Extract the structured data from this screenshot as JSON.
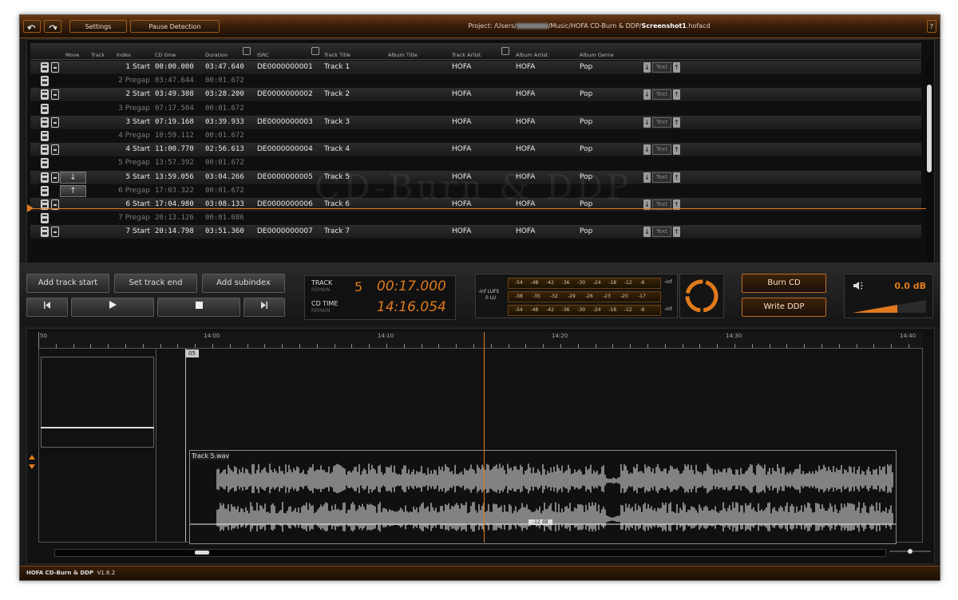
{
  "toolbar": {
    "undo_icon": "undo-icon",
    "redo_icon": "redo-icon",
    "settings_label": "Settings",
    "pause_label": "Pause Detection",
    "project_prefix": "Project: /Users/",
    "project_middle": "/Music/HOFA CD-Burn & DDP/",
    "project_file": "Screenshot1",
    "project_ext": ".hofacd",
    "help_label": "?"
  },
  "columns": {
    "move": "Move",
    "track": "Track",
    "index": "Index",
    "cd_time": "CD time",
    "duration": "Duration",
    "isrc": "ISRC",
    "title": "Track Title",
    "album_title": "Album Title",
    "track_artist": "Track Artist",
    "album_artist": "Album Artist",
    "album_genre": "Album Genre"
  },
  "rows": [
    {
      "type": "start",
      "index": "1 Start",
      "cd_time": "00:00.000",
      "duration": "03:47.640",
      "isrc": "DE0000000001",
      "title": "Track 1",
      "artist": "HOFA",
      "album_artist": "HOFA",
      "genre": "Pop",
      "text": "Text"
    },
    {
      "type": "pregap",
      "index": "2 Pregap",
      "cd_time": "03:47.644",
      "duration": "00:01.672"
    },
    {
      "type": "start",
      "index": "2 Start",
      "cd_time": "03:49.308",
      "duration": "03:28.200",
      "isrc": "DE0000000002",
      "title": "Track 2",
      "artist": "HOFA",
      "album_artist": "HOFA",
      "genre": "Pop",
      "text": "Text"
    },
    {
      "type": "pregap",
      "index": "3 Pregap",
      "cd_time": "07:17.504",
      "duration": "00:01.672"
    },
    {
      "type": "start",
      "index": "3 Start",
      "cd_time": "07:19.168",
      "duration": "03:39.933",
      "isrc": "DE0000000003",
      "title": "Track 3",
      "artist": "HOFA",
      "album_artist": "HOFA",
      "genre": "Pop",
      "text": "Text"
    },
    {
      "type": "pregap",
      "index": "4 Pregap",
      "cd_time": "10:59.112",
      "duration": "00:01.672"
    },
    {
      "type": "start",
      "index": "4 Start",
      "cd_time": "11:00.770",
      "duration": "02:56.613",
      "isrc": "DE0000000004",
      "title": "Track 4",
      "artist": "HOFA",
      "album_artist": "HOFA",
      "genre": "Pop",
      "text": "Text"
    },
    {
      "type": "pregap",
      "index": "5 Pregap",
      "cd_time": "13:57.392",
      "duration": "00:01.672"
    },
    {
      "type": "start",
      "index": "5 Start",
      "cd_time": "13:59.056",
      "duration": "03:04.266",
      "isrc": "DE0000000005",
      "title": "Track 5",
      "artist": "HOFA",
      "album_artist": "HOFA",
      "genre": "Pop",
      "text": "Text",
      "move": "↓"
    },
    {
      "type": "pregap",
      "index": "6 Pregap",
      "cd_time": "17:03.322",
      "duration": "00:01.672",
      "move": "↑"
    },
    {
      "type": "start",
      "index": "6 Start",
      "cd_time": "17:04.980",
      "duration": "03:08.133",
      "isrc": "DE0000000006",
      "title": "Track 6",
      "artist": "HOFA",
      "album_artist": "HOFA",
      "genre": "Pop",
      "text": "Text"
    },
    {
      "type": "pregap",
      "index": "7 Pregap",
      "cd_time": "20:13.126",
      "duration": "00:01.686"
    },
    {
      "type": "start",
      "index": "7 Start",
      "cd_time": "20:14.798",
      "duration": "03:51.360",
      "isrc": "DE0000000007",
      "title": "Track 7",
      "artist": "HOFA",
      "album_artist": "HOFA",
      "genre": "Pop",
      "text": "Text"
    }
  ],
  "watermark": "CD-Burn & DDP",
  "transport": {
    "add_track_start": "Add track start",
    "set_track_end": "Set track end",
    "add_subindex": "Add subindex",
    "prev_icon": "skip-back-icon",
    "play_icon": "play-icon",
    "stop_icon": "stop-icon",
    "next_icon": "skip-forward-icon"
  },
  "display": {
    "track_label": "TRACK",
    "track_sub": "REMAIN",
    "track_number": "5",
    "track_remain": "00:17.000",
    "cd_label": "CD TIME",
    "cd_sub": "REMAIN",
    "cd_remain": "14:16.054"
  },
  "meter": {
    "lufs_label": "-inf LUFS",
    "lu_label": "0 LU",
    "scale_top": [
      "-54",
      "-48",
      "-42",
      "-36",
      "-30",
      "-24",
      "-18",
      "-12",
      "-6"
    ],
    "scale_mid": [
      "-38",
      "-35",
      "-32",
      "-29",
      "-26",
      "-23",
      "-20",
      "-17"
    ],
    "scale_bot": [
      "-54",
      "-48",
      "-42",
      "-36",
      "-30",
      "-24",
      "-18",
      "-12",
      "-6"
    ],
    "inf_label": "-inf"
  },
  "actions": {
    "burn_cd": "Burn CD",
    "write_ddp": "Write DDP"
  },
  "volume": {
    "value": "0.0 dB"
  },
  "ruler": {
    "labels": [
      "50",
      "14:00",
      "14:10",
      "14:20",
      "14:30",
      "14:40"
    ]
  },
  "editor": {
    "marker": "05",
    "clip_name": "Track 5.wav",
    "gain_label": "-12 dB"
  },
  "status": {
    "app_name": "HOFA CD-Burn & DDP",
    "version": "V1.6.2"
  },
  "colors": {
    "accent": "#e07a1c",
    "bg": "#1a1a1a"
  }
}
